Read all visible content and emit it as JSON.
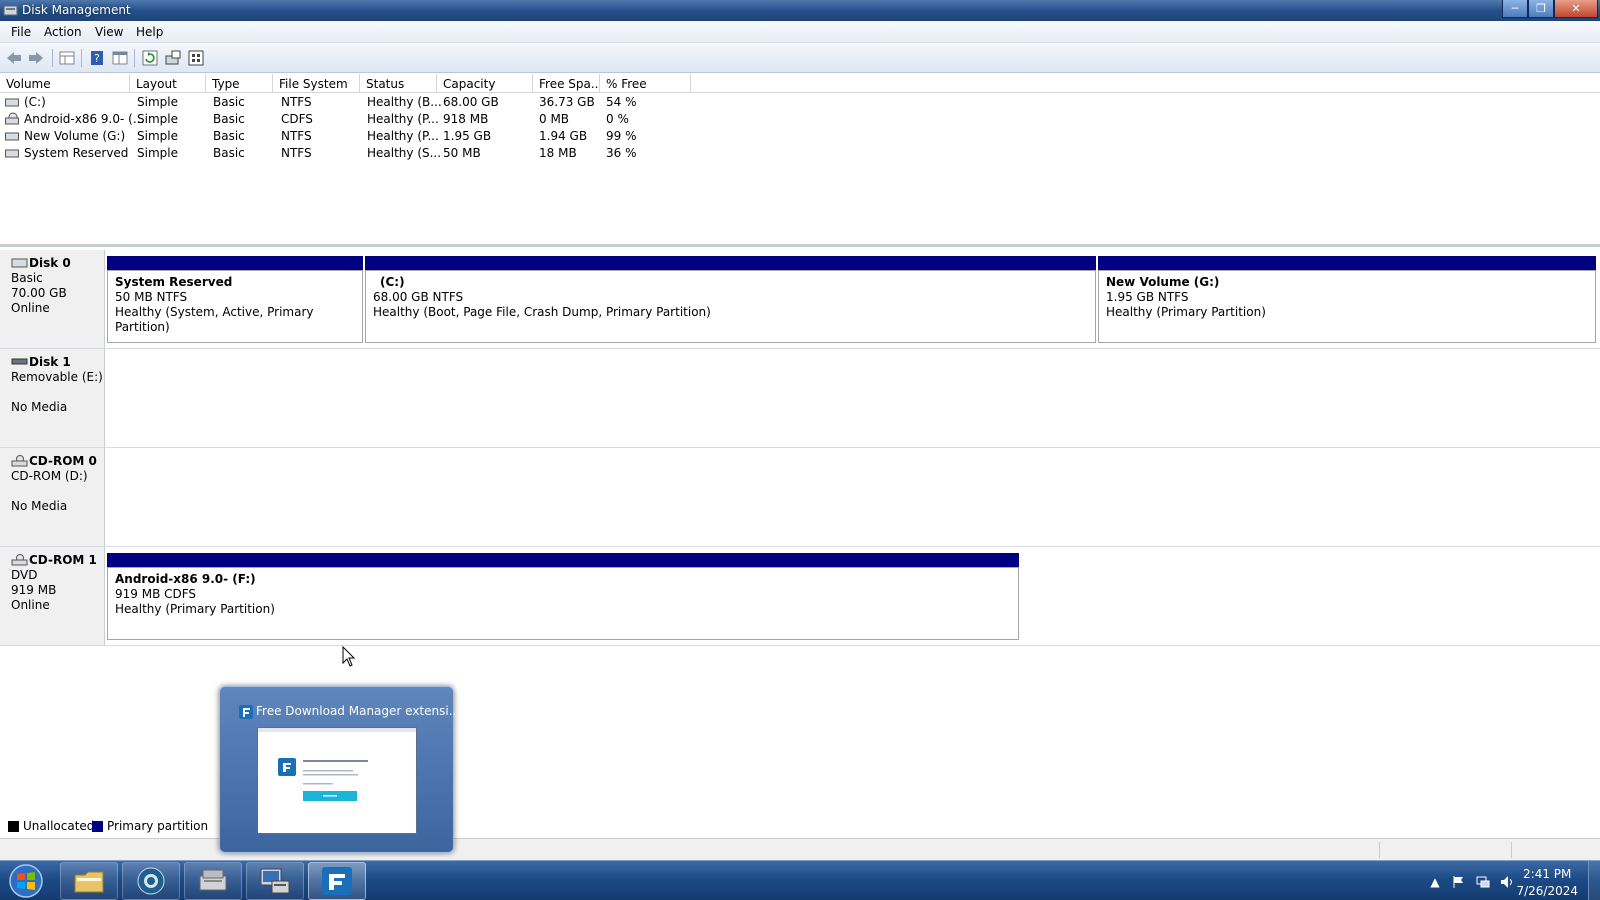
{
  "window": {
    "title": "Disk Management",
    "controls": {
      "minimize": "─",
      "maximize": "❐",
      "close": "✕"
    }
  },
  "menu": [
    "File",
    "Action",
    "View",
    "Help"
  ],
  "toolbar": {
    "icons": [
      "back-icon",
      "forward-icon",
      "properties-grid-icon",
      "help-icon",
      "show-pane-icon",
      "refresh-icon",
      "drive-properties-icon",
      "settings-icon"
    ]
  },
  "volume_list": {
    "columns": [
      "Volume",
      "Layout",
      "Type",
      "File System",
      "Status",
      "Capacity",
      "Free Spa...",
      "% Free"
    ],
    "rows": [
      {
        "volume": "(C:)",
        "layout": "Simple",
        "type": "Basic",
        "fs": "NTFS",
        "status": "Healthy (B...",
        "capacity": "68.00 GB",
        "free": "36.73 GB",
        "pct": "54 %"
      },
      {
        "volume": "Android-x86 9.0- (...",
        "layout": "Simple",
        "type": "Basic",
        "fs": "CDFS",
        "status": "Healthy (P...",
        "capacity": "918 MB",
        "free": "0 MB",
        "pct": "0 %"
      },
      {
        "volume": "New Volume (G:)",
        "layout": "Simple",
        "type": "Basic",
        "fs": "NTFS",
        "status": "Healthy (P...",
        "capacity": "1.95 GB",
        "free": "1.94 GB",
        "pct": "99 %"
      },
      {
        "volume": "System Reserved",
        "layout": "Simple",
        "type": "Basic",
        "fs": "NTFS",
        "status": "Healthy (S...",
        "capacity": "50 MB",
        "free": "18 MB",
        "pct": "36 %"
      }
    ]
  },
  "disks": [
    {
      "name": "Disk 0",
      "line1": "Basic",
      "line2": "70.00 GB",
      "line3": "Online",
      "partitions": [
        {
          "name": "System Reserved",
          "size": "50 MB NTFS",
          "status": "Healthy (System, Active, Primary Partition)"
        },
        {
          "name": "(C:)",
          "size": "68.00 GB NTFS",
          "status": "Healthy (Boot, Page File, Crash Dump, Primary Partition)"
        },
        {
          "name": "New Volume  (G:)",
          "size": "1.95 GB NTFS",
          "status": "Healthy (Primary Partition)"
        }
      ]
    },
    {
      "name": "Disk 1",
      "line1": "Removable (E:)",
      "line2": "",
      "line3": "No Media"
    },
    {
      "name": "CD-ROM 0",
      "line1": "CD-ROM (D:)",
      "line2": "",
      "line3": "No Media"
    },
    {
      "name": "CD-ROM 1",
      "line1": "DVD",
      "line2": "919 MB",
      "line3": "Online",
      "partitions": [
        {
          "name": "Android-x86 9.0-  (F:)",
          "size": "919 MB CDFS",
          "status": "Healthy (Primary Partition)"
        }
      ]
    }
  ],
  "legend": [
    {
      "label": "Unallocated",
      "color": "#000000"
    },
    {
      "label": "Primary partition",
      "color": "#000080"
    }
  ],
  "taskbar": {
    "apps": [
      "explorer-icon",
      "chrome-icon",
      "server-manager-icon",
      "computer-management-icon",
      "fdm-icon"
    ],
    "preview_title": "Free Download Manager extensi...",
    "time": "2:41 PM",
    "date": "7/26/2024"
  }
}
